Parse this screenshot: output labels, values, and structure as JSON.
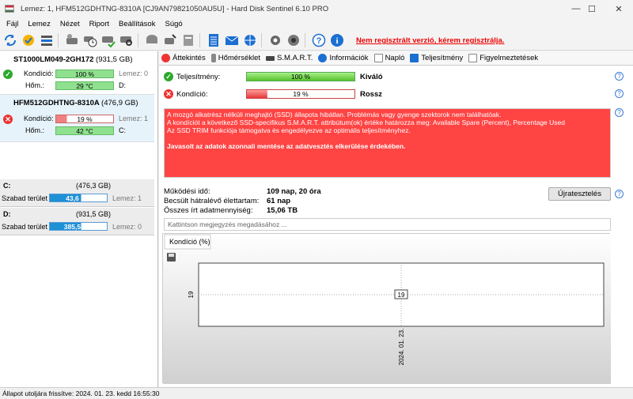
{
  "window": {
    "title": "Lemez: 1, HFM512GDHTNG-8310A [CJ9AN79821050AU5U]  -  Hard Disk Sentinel 6.10 PRO",
    "minimize": "—",
    "maximize": "☐",
    "close": "✕"
  },
  "menu": [
    "Fájl",
    "Lemez",
    "Nézet",
    "Riport",
    "Beállítások",
    "Súgó"
  ],
  "toolbar": {
    "unregistered": "Nem regisztrált verzió, kérem regisztrálja.",
    "icons": [
      "refresh-icon",
      "update-icon",
      "disk-list-icon",
      "disk-icon",
      "disk-clock-icon",
      "disk-check-icon",
      "disk-search-icon",
      "disk-gray-icon",
      "disk-tools-icon",
      "disk-print-icon",
      "report-icon",
      "email-icon",
      "network-icon",
      "settings-icon",
      "speaker-icon",
      "help-icon",
      "info-icon"
    ]
  },
  "disks": [
    {
      "name": "ST1000LM049-2GH172",
      "size": "(931,5 GB)",
      "health_label": "Kondíció:",
      "health": "100 %",
      "health_frac": 1.0,
      "temp_label": "Hőm.:",
      "temp": "29 °C",
      "side1": "Lemez: 0",
      "side2": "D:",
      "status": "ok"
    },
    {
      "name": "HFM512GDHTNG-8310A",
      "size": "(476,9 GB)",
      "health_label": "Kondíció:",
      "health": "19 %",
      "health_frac": 0.19,
      "temp_label": "Hőm.:",
      "temp": "42 °C",
      "side1": "Lemez: 1",
      "side2": "C:",
      "status": "bad"
    }
  ],
  "volumes": [
    {
      "letter": "C:",
      "size": "(476,3 GB)",
      "free_label": "Szabad terület",
      "free": "43,6 GB",
      "free_frac": 0.09,
      "disk": "Lemez: 1"
    },
    {
      "letter": "D:",
      "size": "(931,5 GB)",
      "free_label": "Szabad terület",
      "free": "385,5 GB",
      "free_frac": 0.41,
      "disk": "Lemez: 0"
    }
  ],
  "tabs": [
    "Áttekintés",
    "Hőmérséklet",
    "S.M.A.R.T.",
    "Információk",
    "Napló",
    "Teljesítmény",
    "Figyelmeztetések"
  ],
  "overview": {
    "performance_label": "Teljesítmény:",
    "performance_value": "100 %",
    "performance_frac": 1.0,
    "performance_text": "Kiváló",
    "health_label": "Kondíció:",
    "health_value": "19 %",
    "health_frac": 0.19,
    "health_text": "Rossz",
    "message_lines": [
      "A mozgó alkatrész nélküli meghajtó (SSD) állapota hibátlan. Problémás vagy gyenge szektorok nem találhatóak.",
      "A kondíciót a következő SSD-specifikus S.M.A.R.T. attribútum(ok) értéke határozza meg:  Available Spare (Percent), Percentage Used",
      "Az SSD TRIM funkciója támogatva és engedélyezve az optimális teljesítményhez."
    ],
    "message_warning": "Javasolt az adatok azonnali mentése az adatvesztés elkerülése érdekében.",
    "uptime_label": "Működési idő:",
    "uptime_value": "109 nap, 20 óra",
    "remaining_label": "Becsült hátralévő élettartam:",
    "remaining_value": "61 nap",
    "written_label": "Összes írt adatmennyiség:",
    "written_value": "15,06 TB",
    "retest_button": "Újratesztelés",
    "comment_placeholder": "Kattintson megjegyzés megadásához ..."
  },
  "chart_data": {
    "type": "line",
    "title": "Kondíció  (%)",
    "x": [
      "2024. 01. 23."
    ],
    "series": [
      {
        "values": [
          19
        ]
      }
    ],
    "data_labels": [
      "19"
    ],
    "ytick": "19",
    "ylim": [
      0,
      38
    ],
    "grid": true
  },
  "statusbar": "Állapot utoljára frissítve: 2024. 01. 23. kedd 16:55:30"
}
